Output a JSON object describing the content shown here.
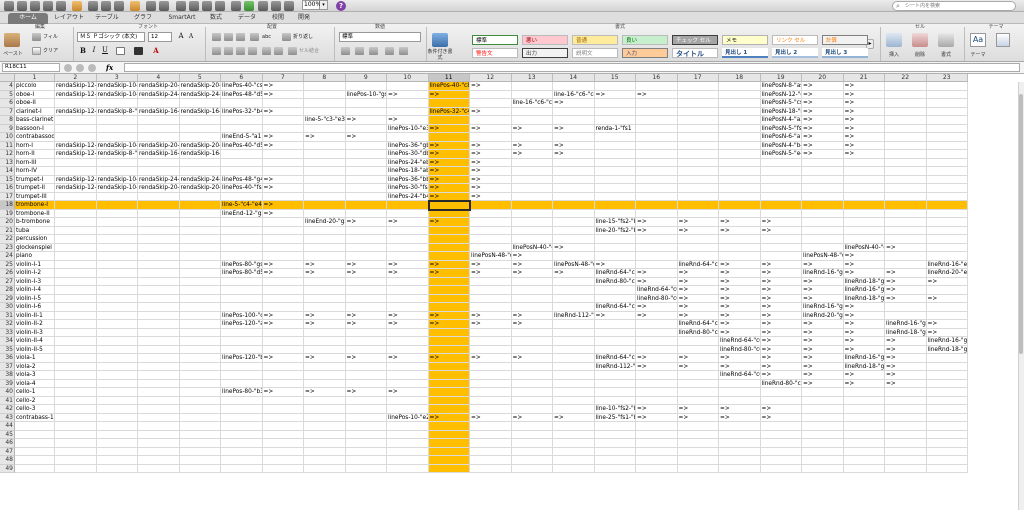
{
  "quick_access": {
    "zoom": "100%",
    "search_placeholder": "シート内を検索"
  },
  "tabs": [
    "ホーム",
    "レイアウト",
    "テーブル",
    "グラフ",
    "SmartArt",
    "数式",
    "データ",
    "校閲",
    "開発"
  ],
  "ribbon": {
    "groups": [
      "編集",
      "フォント",
      "配置",
      "数値",
      "書式",
      "セル",
      "テーマ"
    ],
    "paste_label": "ペースト",
    "fill_label": "フィル",
    "clear_label": "クリア",
    "font_name": "ＭＳ Ｐゴシック (本文)",
    "font_size": "12",
    "wrap_label": "折り返し",
    "abc_label": "abc",
    "merge_label": "セル結合",
    "number_format": "標準",
    "conditional_label": "条件付き書式",
    "cell_styles": [
      {
        "label": "標準",
        "bg": "#ffffff",
        "color": "#000000",
        "border": "#3c8c3c"
      },
      {
        "label": "悪い",
        "bg": "#ffc7ce",
        "color": "#9c0006",
        "border": "#bbbbbb"
      },
      {
        "label": "普通",
        "bg": "#ffeb9c",
        "color": "#9c6500",
        "border": "#bbbbbb"
      },
      {
        "label": "良い",
        "bg": "#c6efce",
        "color": "#006100",
        "border": "#bbbbbb"
      },
      {
        "label": "チェック セル",
        "bg": "#a5a5a5",
        "color": "#ffffff",
        "border": "#3f3f3f"
      },
      {
        "label": "メモ",
        "bg": "#ffffcc",
        "color": "#000000",
        "border": "#b2b2b2"
      },
      {
        "label": "リンク セル",
        "bg": "#ffffff",
        "color": "#fa7d00",
        "border": "#bbbbbb"
      },
      {
        "label": "計算",
        "bg": "#f2f2f2",
        "color": "#fa7d00",
        "border": "#7f7f7f"
      },
      {
        "label": "警告文",
        "bg": "#ffffff",
        "color": "#ff0000",
        "border": "#bbbbbb"
      },
      {
        "label": "出力",
        "bg": "#f2f2f2",
        "color": "#3f3f3f",
        "border": "#3f3f3f"
      },
      {
        "label": "説明文",
        "bg": "#ffffff",
        "color": "#7f7f7f",
        "border": "#bbbbbb"
      },
      {
        "label": "入力",
        "bg": "#ffcc99",
        "color": "#3f3f76",
        "border": "#7f7f7f"
      },
      {
        "label": "タイトル",
        "bg": "#ffffff",
        "color": "#1f497d",
        "border": "#bbbbbb"
      },
      {
        "label": "見出し 1",
        "bg": "#ffffff",
        "color": "#1f497d",
        "border": "#4f81bd"
      },
      {
        "label": "見出し 2",
        "bg": "#ffffff",
        "color": "#1f497d",
        "border": "#a7bfde"
      },
      {
        "label": "見出し 3",
        "bg": "#ffffff",
        "color": "#1f497d",
        "border": "#95b3d7"
      }
    ],
    "insert_label": "挿入",
    "delete_label": "削除",
    "format_label": "書式",
    "theme_label": "テーマ",
    "aa_label": "Aa"
  },
  "formula_bar": {
    "name_box": "R18C11",
    "fx_label": "fx",
    "value": ""
  },
  "selection": {
    "row": 18,
    "col": 11,
    "highlight_color": "#ffbf00"
  },
  "columns": [
    "1",
    "2",
    "3",
    "4",
    "5",
    "6",
    "7",
    "8",
    "9",
    "10",
    "11",
    "12",
    "13",
    "14",
    "15",
    "16",
    "17",
    "18",
    "19",
    "20",
    "21",
    "22",
    "23"
  ],
  "rows": [
    {
      "n": 4,
      "c": {
        "1": "piccolo",
        "2": "rendaSkip-12-",
        "3": "rendaSkip-10-",
        "4": "rendaSkip-20-",
        "5": "rendaSkip-20-\"cs7-31-1",
        "6": "linePos-40-\"cs",
        "7": "=>",
        "11": "linePos-40-\"c8",
        "12": "=>",
        "19": "linePosN-8-\"as",
        "20": "=>",
        "21": "=>"
      }
    },
    {
      "n": 5,
      "c": {
        "1": "oboe-I",
        "2": "rendaSkip-12-",
        "3": "rendaSkip-10-",
        "4": "rendaSkip-24-",
        "5": "rendaSkip-24-\"d5-31-1",
        "6": "linePos-48-\"d5",
        "7": "=>",
        "9": "linePos-10-\"gs",
        "10": "=>",
        "11": "=>",
        "14": "line-16-\"c6-\"c4",
        "15": "=>",
        "16": "=>",
        "19": "linePosN-12-\"g",
        "20": "=>",
        "21": "=>"
      }
    },
    {
      "n": 6,
      "c": {
        "1": "oboe-II",
        "13": "line-16-\"c6-\"c4",
        "14": "=>",
        "19": "linePosN-5-\"cs",
        "20": "=>",
        "21": "=>"
      }
    },
    {
      "n": 7,
      "c": {
        "1": "clarinet-I",
        "2": "rendaSkip-12-",
        "3": "rendaSkip-8-\"b",
        "4": "rendaSkip-16-",
        "5": "rendaSkip-16-\"b4-31-1",
        "6": "linePos-32-\"b4",
        "7": "=>",
        "11": "linePos-32-\"c4",
        "12": "=>",
        "19": "linePosN-18-\"b",
        "20": "=>",
        "21": "=>"
      }
    },
    {
      "n": 8,
      "c": {
        "1": "bass-clarinet",
        "8": "line-5-\"c3-\"e3",
        "9": "=>",
        "10": "=>",
        "19": "linePosN-4-\"a3",
        "20": "=>",
        "21": "=>"
      }
    },
    {
      "n": 9,
      "c": {
        "1": "bassoon-I",
        "10": "linePos-10-\"e3",
        "11": "=>",
        "12": "=>",
        "13": "=>",
        "14": "=>",
        "15": "renda-1-\"fs1",
        "19": "linePosN-5-\"fs",
        "20": "=>",
        "21": "=>"
      }
    },
    {
      "n": 10,
      "c": {
        "1": "contrabassoon",
        "6": "lineEnd-5-\"a1",
        "7": "=>",
        "8": "=>",
        "9": "=>",
        "19": "linePosN-6-\"a1",
        "20": "=>",
        "21": "=>"
      }
    },
    {
      "n": 11,
      "c": {
        "1": "horn-I",
        "2": "rendaSkip-12-",
        "3": "rendaSkip-10-",
        "4": "rendaSkip-20-",
        "5": "rendaSkip-20-\"d5-31-1",
        "6": "linePos-40-\"d5",
        "7": "=>",
        "10": "linePos-36-\"gb",
        "11": "=>",
        "12": "=>",
        "13": "=>",
        "14": "=>",
        "19": "linePosN-4-\"b4",
        "20": "=>",
        "21": "=>"
      }
    },
    {
      "n": 12,
      "c": {
        "1": "horn-II",
        "2": "rendaSkip-12-",
        "3": "rendaSkip-8-\"b",
        "4": "rendaSkip-16-",
        "5": "rendaSkip-16-\"d5-31-1",
        "10": "linePos-30-\"db",
        "11": "=>",
        "12": "=>",
        "13": "=>",
        "14": "=>",
        "19": "linePosN-5-\"e4",
        "20": "=>",
        "21": "=>"
      }
    },
    {
      "n": 13,
      "c": {
        "1": "horn-III",
        "10": "linePos-24-\"eb",
        "11": "=>",
        "12": "=>"
      }
    },
    {
      "n": 14,
      "c": {
        "1": "horn-IV",
        "10": "linePos-18-\"ab",
        "11": "=>",
        "12": "=>"
      }
    },
    {
      "n": 15,
      "c": {
        "1": "trumpet-I",
        "2": "rendaSkip-12-",
        "3": "rendaSkip-10-",
        "4": "rendaSkip-24-",
        "5": "rendaSkip-24-\"g4-31-1",
        "6": "linePos-48-\"g4",
        "7": "=>",
        "10": "linePos-36-\"bb",
        "11": "=>",
        "12": "=>"
      }
    },
    {
      "n": 16,
      "c": {
        "1": "trumpet-II",
        "2": "rendaSkip-12-",
        "3": "rendaSkip-10-",
        "4": "rendaSkip-20-",
        "5": "rendaSkip-20-\"fs4-31-1",
        "6": "linePos-40-\"fs",
        "7": "=>",
        "10": "linePos-30-\"fs",
        "11": "=>",
        "12": "=>"
      }
    },
    {
      "n": 17,
      "c": {
        "1": "trumpet-III",
        "10": "linePos-24-\"b4",
        "11": "=>",
        "12": "=>"
      }
    },
    {
      "n": 18,
      "sel": true,
      "c": {
        "1": "trombone-I",
        "6": "line-5-\"c4-\"e4",
        "7": "=>"
      }
    },
    {
      "n": 19,
      "c": {
        "1": "trombone-II",
        "6": "lineEnd-12-\"g3",
        "7": "=>"
      }
    },
    {
      "n": 20,
      "c": {
        "1": "b-trombone",
        "8": "lineEnd-20-\"g2",
        "9": "=>",
        "10": "=>",
        "11": "=>",
        "15": "line-15-\"fs2-\"b",
        "16": "=>",
        "17": "=>",
        "18": "=>",
        "19": "=>"
      }
    },
    {
      "n": 21,
      "c": {
        "1": "tuba",
        "15": "line-20-\"fs2-\"b",
        "16": "=>",
        "17": "=>",
        "18": "=>",
        "19": "=>"
      }
    },
    {
      "n": 22,
      "c": {
        "1": "percussion"
      }
    },
    {
      "n": 23,
      "c": {
        "1": "glockenspiel",
        "13": "linePosN-40-\"c",
        "14": "=>",
        "21": "linePosN-40-\"c",
        "22": "=>"
      }
    },
    {
      "n": 24,
      "c": {
        "1": "piano",
        "12": "linePosN-48-\"c",
        "13": "=>",
        "20": "linePosN-48-\"c",
        "21": "=>"
      }
    },
    {
      "n": 25,
      "c": {
        "1": "violin-I-1",
        "6": "linePos-80-\"gs",
        "7": "=>",
        "8": "=>",
        "9": "=>",
        "10": "=>",
        "11": "=>",
        "12": "=>",
        "13": "=>",
        "14": "linePosN-48-\"c",
        "15": "=>",
        "17": "lineRnd-64-\"c6",
        "18": "=>",
        "19": "=>",
        "20": "=>",
        "21": "=>",
        "23": "lineRnd-16-\"e6"
      }
    },
    {
      "n": 26,
      "c": {
        "1": "violin-I-2",
        "6": "linePos-80-\"d5",
        "7": "=>",
        "8": "=>",
        "9": "=>",
        "10": "=>",
        "11": "=>",
        "12": "=>",
        "13": "=>",
        "14": "=>",
        "15": "lineRnd-64-\"c6",
        "16": "=>",
        "17": "=>",
        "18": "=>",
        "19": "=>",
        "20": "lineRnd-16-\"g5",
        "21": "=>",
        "22": "=>",
        "23": "lineRnd-20-\"e6"
      }
    },
    {
      "n": 27,
      "c": {
        "1": "violin-I-3",
        "15": "lineRnd-80-\"c6",
        "16": "=>",
        "17": "=>",
        "18": "=>",
        "19": "=>",
        "20": "=>",
        "21": "lineRnd-18-\"g5",
        "22": "=>",
        "23": "=>"
      }
    },
    {
      "n": 28,
      "c": {
        "1": "violin-I-4",
        "16": "lineRnd-64-\"c6",
        "17": "=>",
        "18": "=>",
        "19": "=>",
        "20": "=>",
        "21": "lineRnd-16-\"g5",
        "22": "=>"
      }
    },
    {
      "n": 29,
      "c": {
        "1": "violin-I-5",
        "16": "lineRnd-80-\"c6",
        "17": "=>",
        "18": "=>",
        "19": "=>",
        "20": "=>",
        "21": "lineRnd-18-\"g5",
        "22": "=>",
        "23": "=>"
      }
    },
    {
      "n": 30,
      "c": {
        "1": "violin-I-6",
        "15": "lineRnd-64-\"c6",
        "16": "=>",
        "17": "=>",
        "18": "=>",
        "19": "=>",
        "20": "lineRnd-16-\"g5",
        "21": "=>"
      }
    },
    {
      "n": 31,
      "c": {
        "1": "violin-II-1",
        "6": "linePos-100-\"c",
        "7": "=>",
        "8": "=>",
        "9": "=>",
        "10": "=>",
        "11": "=>",
        "12": "=>",
        "13": "=>",
        "14": "lineRnd-112-\"c",
        "15": "=>",
        "16": "=>",
        "17": "=>",
        "18": "=>",
        "19": "=>",
        "20": "lineRnd-20-\"g5",
        "21": "=>"
      }
    },
    {
      "n": 32,
      "c": {
        "1": "violin-II-2",
        "6": "linePos-120-\"a",
        "7": "=>",
        "8": "=>",
        "9": "=>",
        "10": "=>",
        "11": "=>",
        "12": "=>",
        "13": "=>",
        "17": "lineRnd-64-\"c6",
        "18": "=>",
        "19": "=>",
        "20": "=>",
        "21": "=>",
        "22": "lineRnd-16-\"g5",
        "23": "=>"
      }
    },
    {
      "n": 33,
      "c": {
        "1": "violin-II-3",
        "17": "lineRnd-80-\"c6",
        "18": "=>",
        "19": "=>",
        "20": "=>",
        "21": "=>",
        "22": "lineRnd-18-\"g5",
        "23": "=>"
      }
    },
    {
      "n": 34,
      "c": {
        "1": "violin-II-4",
        "18": "lineRnd-64-\"c6",
        "19": "=>",
        "20": "=>",
        "21": "=>",
        "22": "=>",
        "23": "lineRnd-16-\"g5"
      }
    },
    {
      "n": 35,
      "c": {
        "1": "violin-II-5",
        "18": "lineRnd-80-\"c6",
        "19": "=>",
        "20": "=>",
        "21": "=>",
        "22": "=>",
        "23": "lineRnd-18-\"g5"
      }
    },
    {
      "n": 36,
      "c": {
        "1": "viola-1",
        "6": "linePos-120-\"b",
        "7": "=>",
        "8": "=>",
        "9": "=>",
        "10": "=>",
        "11": "=>",
        "12": "=>",
        "13": "=>",
        "15": "lineRnd-64-\"c6",
        "16": "=>",
        "17": "=>",
        "18": "=>",
        "19": "=>",
        "20": "=>",
        "21": "lineRnd-16-\"g5",
        "22": "=>"
      }
    },
    {
      "n": 37,
      "c": {
        "1": "viola-2",
        "15": "lineRnd-112-\"c",
        "16": "=>",
        "17": "=>",
        "18": "=>",
        "19": "=>",
        "20": "=>",
        "21": "lineRnd-18-\"g5",
        "22": "=>"
      }
    },
    {
      "n": 38,
      "c": {
        "1": "viola-3",
        "18": "lineRnd-64-\"c6",
        "19": "=>",
        "20": "=>",
        "21": "=>",
        "22": "=>"
      }
    },
    {
      "n": 39,
      "c": {
        "1": "viola-4",
        "19": "lineRnd-80-\"c6",
        "20": "=>",
        "21": "=>",
        "22": "=>"
      }
    },
    {
      "n": 40,
      "c": {
        "1": "cello-1",
        "6": "linePos-80-\"b3",
        "7": "=>",
        "8": "=>",
        "9": "=>",
        "10": "=>"
      }
    },
    {
      "n": 41,
      "c": {
        "1": "cello-2"
      }
    },
    {
      "n": 42,
      "c": {
        "1": "cello-3",
        "15": "line-10-\"fs2-\"b",
        "16": "=>",
        "17": "=>",
        "18": "=>",
        "19": "=>"
      }
    },
    {
      "n": 43,
      "c": {
        "1": "contrabass-1",
        "10": "linePos-10-\"e2",
        "11": "=>",
        "12": "=>",
        "13": "=>",
        "14": "=>",
        "15": "line-25-\"fs1-\"b",
        "16": "=>",
        "17": "=>",
        "18": "=>",
        "19": "=>"
      }
    },
    {
      "n": 44,
      "c": {}
    },
    {
      "n": 45,
      "c": {}
    },
    {
      "n": 46,
      "c": {}
    },
    {
      "n": 47,
      "c": {}
    },
    {
      "n": 48,
      "c": {}
    },
    {
      "n": 49,
      "c": {}
    }
  ]
}
